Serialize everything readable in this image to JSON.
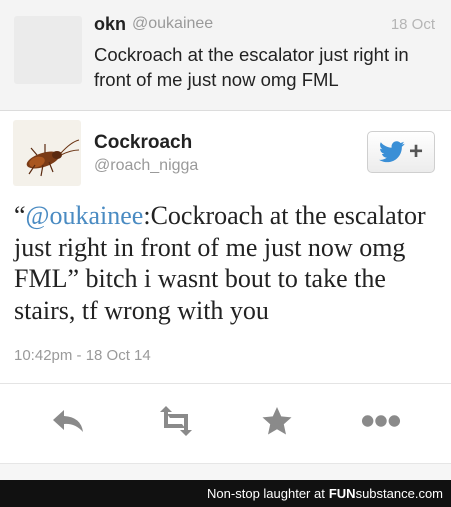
{
  "quoted_tweet": {
    "name": "okn",
    "handle": "@oukainee",
    "date": "18 Oct",
    "text": "Cockroach at the escalator just right in front of me just now omg FML"
  },
  "tweet": {
    "name": "Cockroach",
    "handle": "@roach_nigga",
    "open_quote": "“",
    "mention": "@oukainee",
    "body": ":Cockroach at the escalator just right in front of me just now omg FML” bitch i wasnt bout to take the stairs, tf wrong with you",
    "timestamp": "10:42pm - 18 Oct 14"
  },
  "follow_button": {
    "icon": "twitter-bird-icon",
    "plus": "+"
  },
  "actions": [
    "reply-icon",
    "retweet-icon",
    "favorite-icon",
    "more-icon"
  ],
  "footer": {
    "text": "Non-stop laughter at",
    "brand_a": "FUN",
    "brand_b": "substance",
    "brand_c": ".com"
  },
  "colors": {
    "link": "#4a8bc2",
    "twitter_blue": "#3a8fd6",
    "icon_gray": "#8a8a8a"
  }
}
